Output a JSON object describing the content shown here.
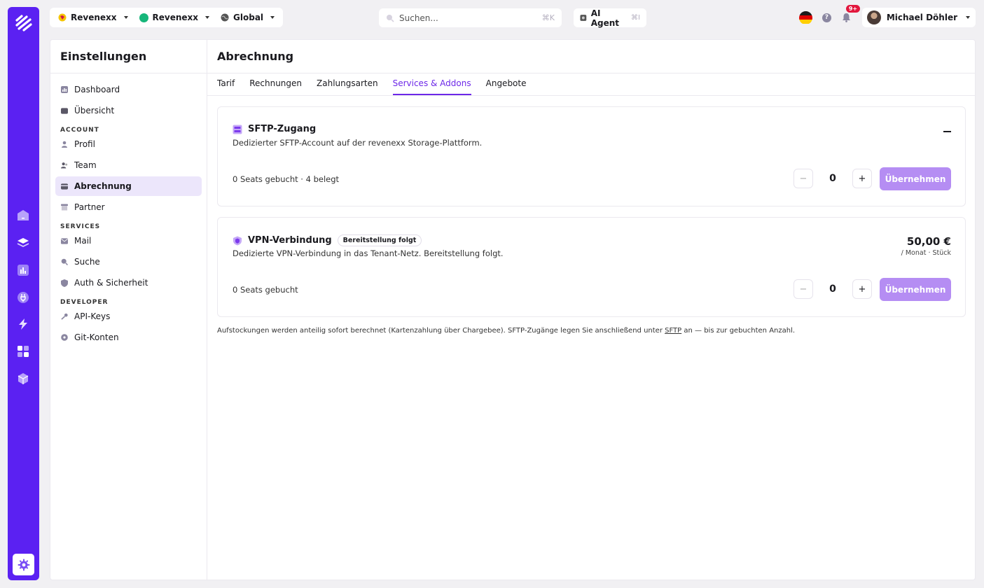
{
  "topbar": {
    "scope": [
      {
        "label": "Revenexx",
        "icon": "org-badge-icon",
        "color": "#f5c400"
      },
      {
        "label": "Revenexx",
        "icon": "green-dot-icon",
        "color": "#16b67a"
      },
      {
        "label": "Global",
        "icon": "globe-icon",
        "color": "#555555"
      }
    ],
    "search_placeholder": "Suchen...",
    "search_shortcut": "⌘K",
    "ai_label": "AI Agent",
    "ai_shortcut": "⌘I",
    "notifications_badge": "9+",
    "user_name": "Michael Döhler"
  },
  "sidebar": {
    "title": "Einstellungen",
    "items": [
      {
        "type": "item",
        "label": "Dashboard",
        "icon": "dashboard-icon"
      },
      {
        "type": "item",
        "label": "Übersicht",
        "icon": "overview-icon"
      },
      {
        "type": "section",
        "label": "ACCOUNT"
      },
      {
        "type": "item",
        "label": "Profil",
        "icon": "user-icon"
      },
      {
        "type": "item",
        "label": "Team",
        "icon": "team-icon"
      },
      {
        "type": "item",
        "label": "Abrechnung",
        "icon": "billing-icon",
        "active": true
      },
      {
        "type": "item",
        "label": "Partner",
        "icon": "partner-icon"
      },
      {
        "type": "section",
        "label": "SERVICES"
      },
      {
        "type": "item",
        "label": "Mail",
        "icon": "mail-icon"
      },
      {
        "type": "item",
        "label": "Suche",
        "icon": "search-icon"
      },
      {
        "type": "item",
        "label": "Auth & Sicherheit",
        "icon": "shield-icon"
      },
      {
        "type": "section",
        "label": "DEVELOPER"
      },
      {
        "type": "item",
        "label": "API-Keys",
        "icon": "key-icon"
      },
      {
        "type": "item",
        "label": "Git-Konten",
        "icon": "git-icon"
      }
    ]
  },
  "main": {
    "title": "Abrechnung",
    "tabs": [
      {
        "label": "Tarif"
      },
      {
        "label": "Rechnungen"
      },
      {
        "label": "Zahlungsarten"
      },
      {
        "label": "Services & Addons",
        "active": true
      },
      {
        "label": "Angebote"
      }
    ],
    "cards": [
      {
        "title": "SFTP-Zugang",
        "icon": "server-icon",
        "description": "Dedizierter SFTP-Account auf der revenexx Storage-Plattform.",
        "seats": "0 Seats gebucht · 4 belegt",
        "quantity": "0",
        "apply_label": "Übernehmen"
      },
      {
        "title": "VPN-Verbindung",
        "icon": "shield-icon",
        "badge": "Bereitstellung folgt",
        "description": "Dedizierte VPN-Verbindung in das Tenant-Netz. Bereitstellung folgt.",
        "price": "50,00 €",
        "price_unit": "/ Monat · Stück",
        "seats": "0 Seats gebucht",
        "quantity": "0",
        "apply_label": "Übernehmen"
      }
    ],
    "note_before": "Aufstockungen werden anteilig sofort berechnet (Kartenzahlung über Chargebee). SFTP-Zugänge legen Sie anschließend unter ",
    "note_link": "SFTP",
    "note_after": " an — bis zur gebuchten Anzahl."
  },
  "colors": {
    "accent": "#6d28e8",
    "rail": "#5b21f2",
    "apply": "#b58df3"
  }
}
